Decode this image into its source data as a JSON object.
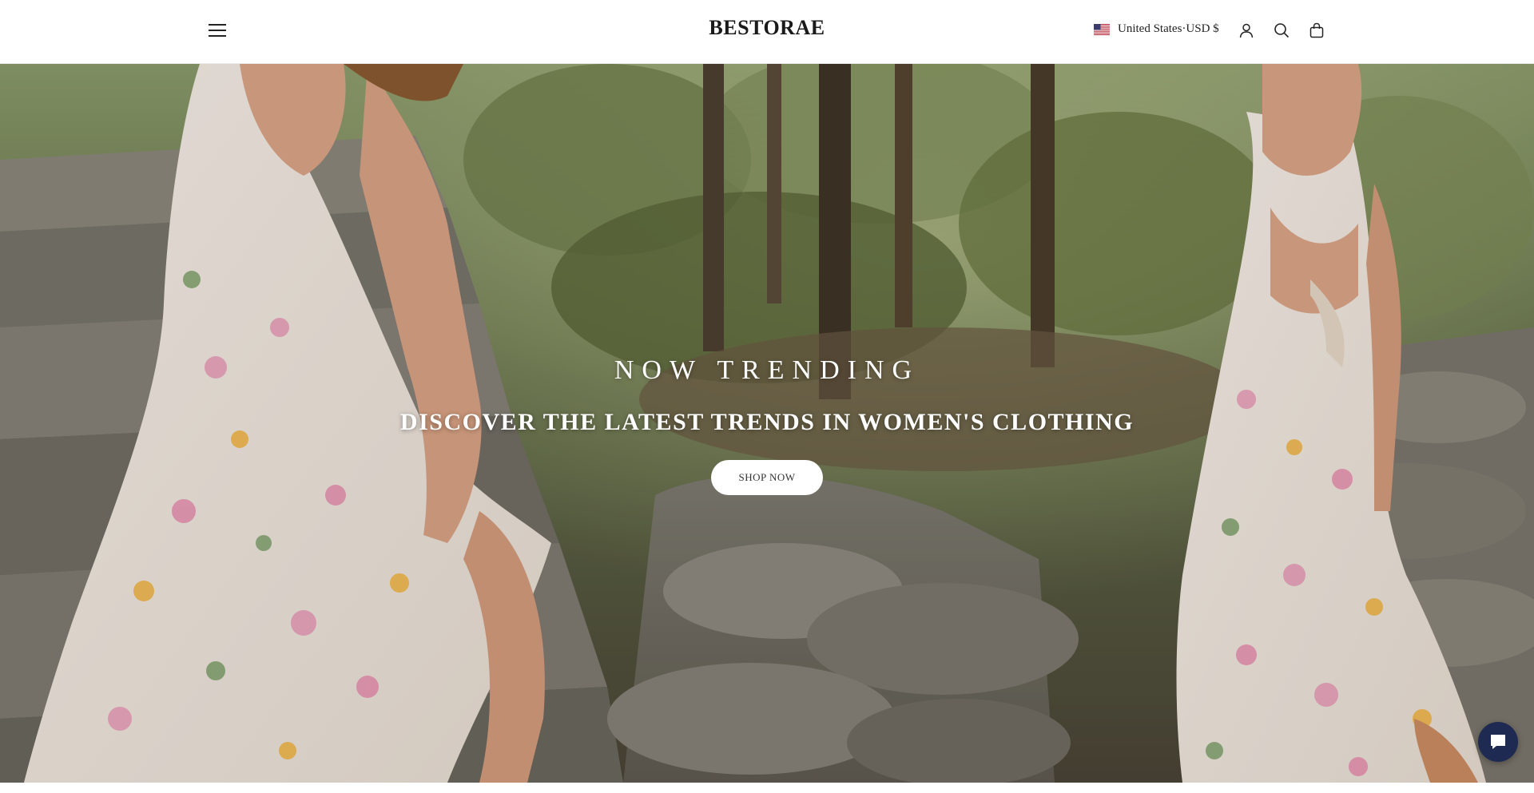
{
  "header": {
    "logo": "BESTORAE",
    "locale": {
      "flag_icon": "us-flag-icon",
      "label": "United States·USD $"
    },
    "icons": [
      "menu-icon",
      "account-icon",
      "search-icon",
      "cart-bag-icon"
    ]
  },
  "hero": {
    "eyebrow": "NOW TRENDING",
    "heading": "DISCOVER THE LATEST TRENDS IN WOMEN'S CLOTHING",
    "cta_label": "SHOP NOW",
    "scene": "two women in floral dresses on stone steps in a forest"
  },
  "chat": {
    "icon": "chat-icon",
    "color": "#1e2a52"
  },
  "colors": {
    "header_bg": "#ffffff",
    "text_dark": "#1a1a1a",
    "hero_text": "#ffffff",
    "button_bg": "#ffffff"
  }
}
